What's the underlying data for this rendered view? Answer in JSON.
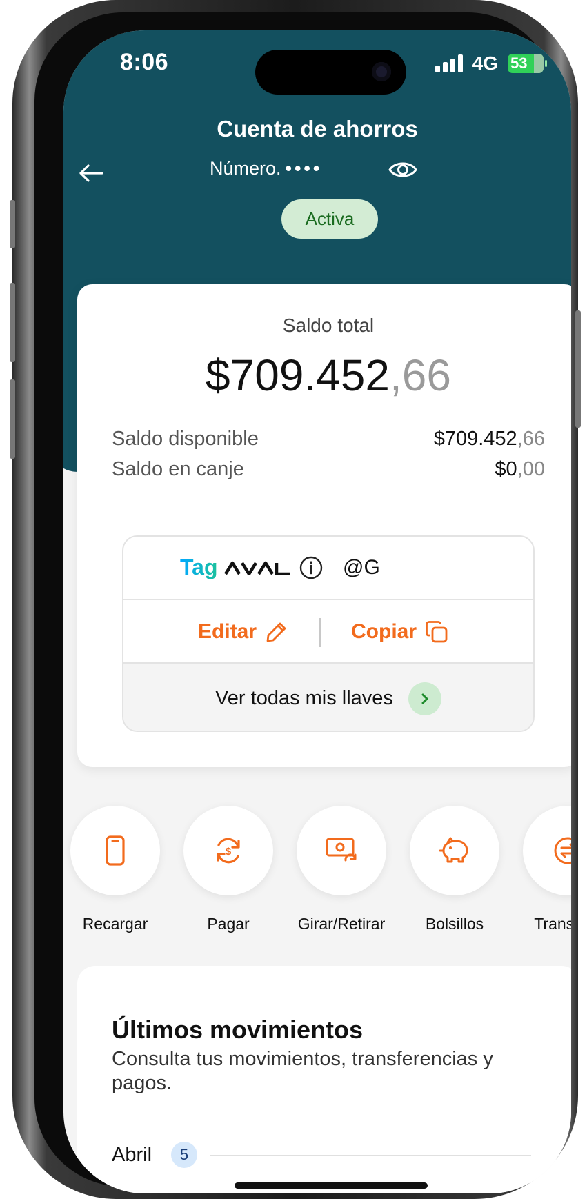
{
  "status_bar": {
    "time": "8:06",
    "network": "4G",
    "battery": "53"
  },
  "header": {
    "title": "Cuenta de ahorros",
    "account_label": "Número.",
    "account_mask": "••••",
    "status_badge": "Activa"
  },
  "balance": {
    "total_label": "Saldo total",
    "total_int": "$709.452",
    "total_cents": ",66",
    "rows": [
      {
        "label": "Saldo disponible",
        "int": "$709.452",
        "cents": ",66"
      },
      {
        "label": "Saldo en canje",
        "int": "$0",
        "cents": ",00"
      }
    ]
  },
  "tag": {
    "brand_prefix": "Tag",
    "brand_logo": "aval-logo",
    "handle": "@G",
    "edit_label": "Editar",
    "copy_label": "Copiar",
    "all_keys_label": "Ver todas mis llaves"
  },
  "quick_actions": [
    {
      "label": "Recargar",
      "icon": "phone-icon"
    },
    {
      "label": "Pagar",
      "icon": "pay-cycle-icon"
    },
    {
      "label": "Girar/Retirar",
      "icon": "cash-withdraw-icon"
    },
    {
      "label": "Bolsillos",
      "icon": "piggy-bank-icon"
    },
    {
      "label": "Transferir",
      "icon": "transfer-icon"
    }
  ],
  "movements": {
    "title": "Últimos movimientos",
    "subtitle": "Consulta tus movimientos, transferencias y pagos.",
    "month": "Abril",
    "month_count": "5"
  },
  "colors": {
    "header": "#13505f",
    "accent": "#f26b1d",
    "badge_bg": "#d3ecd4",
    "badge_text": "#1a6b1f"
  }
}
